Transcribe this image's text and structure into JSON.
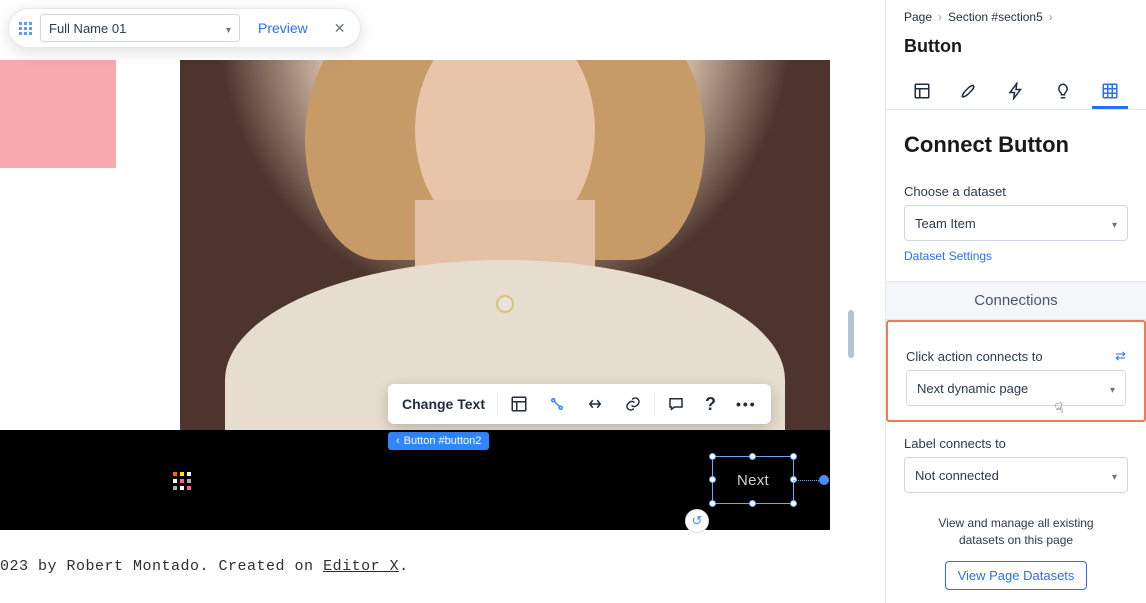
{
  "pill": {
    "selected": "Full Name 01",
    "preview": "Preview"
  },
  "canvas": {
    "change_text": "Change Text",
    "button_tag": "Button #button2",
    "selected_label": "Next",
    "footer_prefix": "023 by Robert Montado. Created on ",
    "footer_link": "Editor X",
    "footer_suffix": "."
  },
  "panel": {
    "breadcrumb": {
      "page": "Page",
      "section": "Section #section5"
    },
    "title": "Button",
    "section_title": "Connect Button",
    "dataset_label": "Choose a dataset",
    "dataset_value": "Team Item",
    "dataset_settings": "Dataset Settings",
    "connections_header": "Connections",
    "click_label": "Click action connects to",
    "click_value": "Next dynamic page",
    "label_label": "Label connects to",
    "label_value": "Not connected",
    "bottom_note": "View and manage all existing datasets on this page",
    "view_page_btn": "View Page Datasets"
  }
}
